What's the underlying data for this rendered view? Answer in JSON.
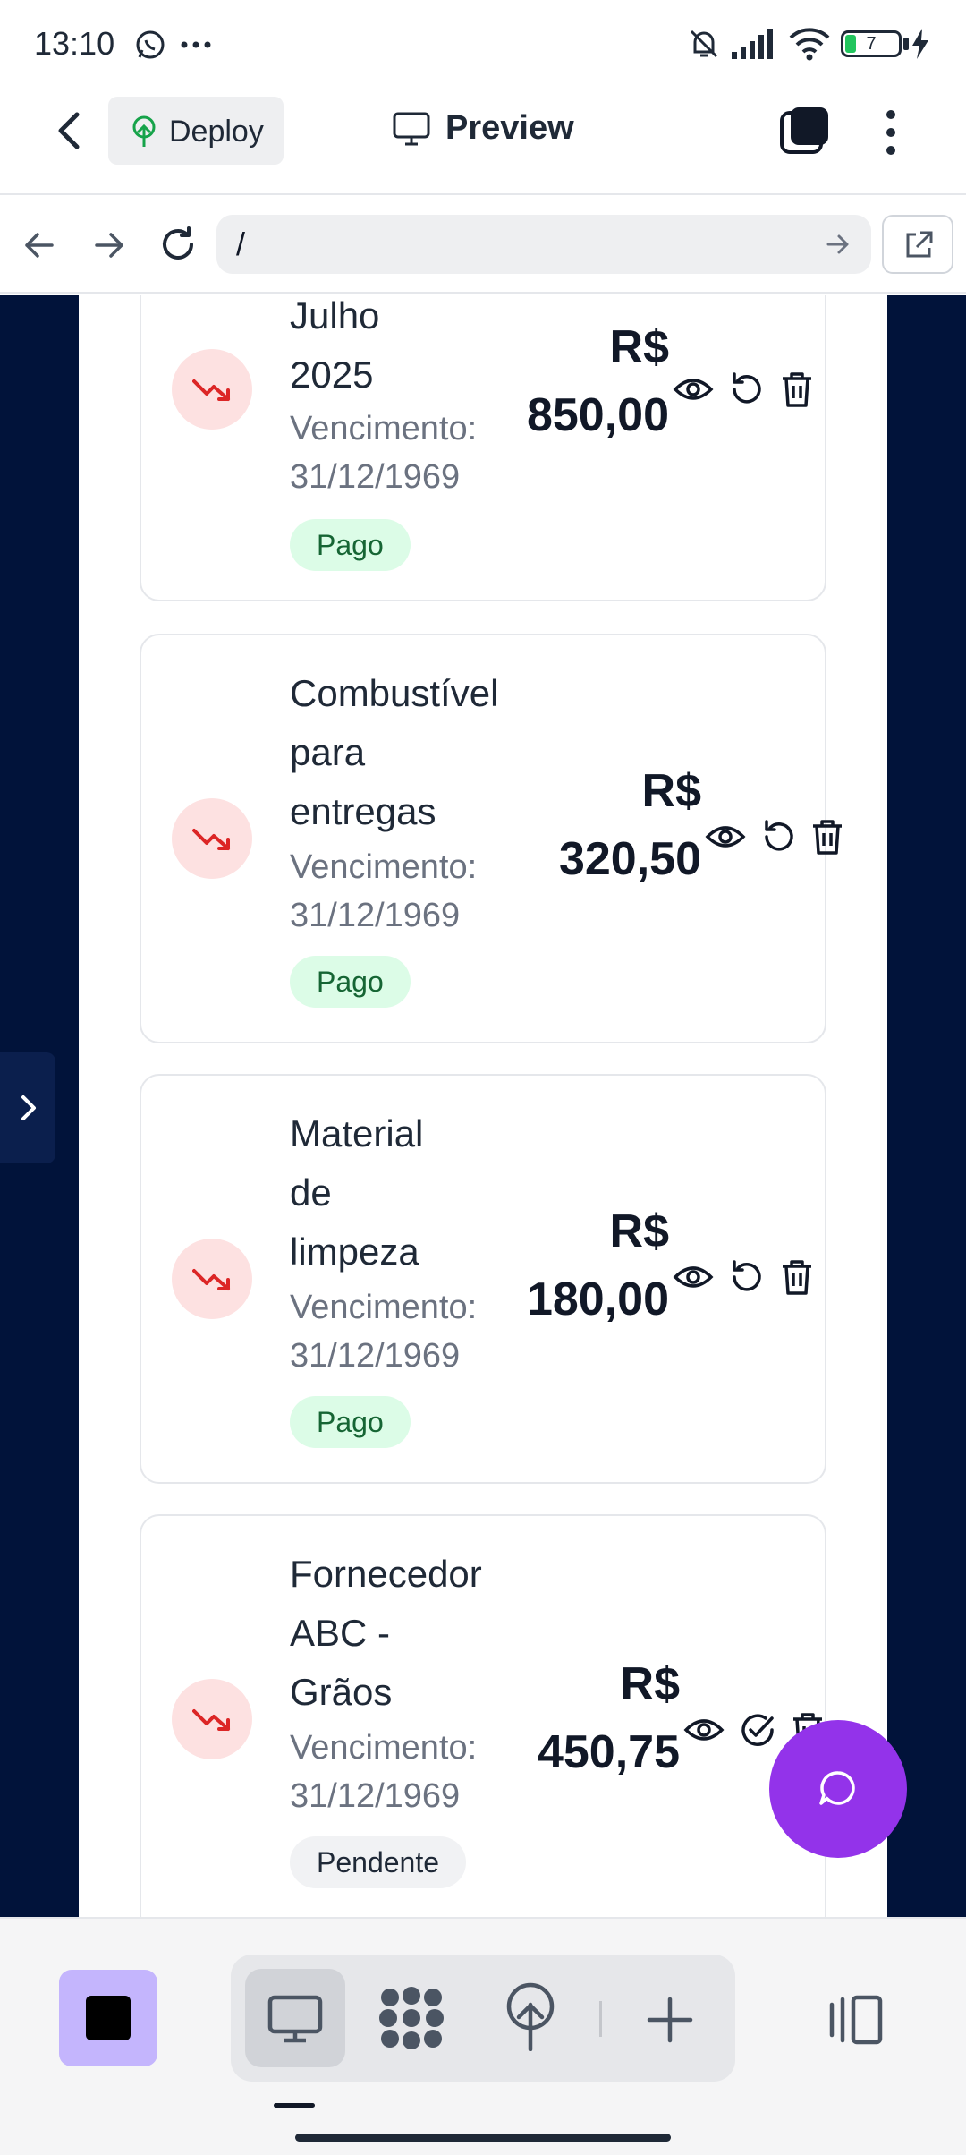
{
  "status_bar": {
    "time": "13:10",
    "battery": "7"
  },
  "app_bar": {
    "deploy_label": "Deploy",
    "preview_label": "Preview"
  },
  "url_bar": {
    "path": "/"
  },
  "colors": {
    "accent_purple": "#9333ea",
    "page_bg": "#01133a",
    "paid_badge": "#dcfce7",
    "expense_icon": "#dc2626"
  },
  "expenses": [
    {
      "title_lines": [
        "Julho",
        "2025"
      ],
      "due_label": "Vencimento:",
      "due_date": "31/12/1969",
      "currency": "R$",
      "amount": "850,00",
      "status": "Pago",
      "actions": [
        "eye-icon",
        "undo-icon",
        "trash-icon"
      ]
    },
    {
      "title_lines": [
        "Combustível",
        "para",
        "entregas"
      ],
      "due_label": "Vencimento:",
      "due_date": "31/12/1969",
      "currency": "R$",
      "amount": "320,50",
      "status": "Pago",
      "actions": [
        "eye-icon",
        "undo-icon",
        "trash-icon"
      ]
    },
    {
      "title_lines": [
        "Material",
        "de",
        "limpeza"
      ],
      "due_label": "Vencimento:",
      "due_date": "31/12/1969",
      "currency": "R$",
      "amount": "180,00",
      "status": "Pago",
      "actions": [
        "eye-icon",
        "undo-icon",
        "trash-icon"
      ]
    },
    {
      "title_lines": [
        "Fornecedor",
        "ABC -",
        "Grãos"
      ],
      "due_label": "Vencimento:",
      "due_date": "31/12/1969",
      "currency": "R$",
      "amount": "450,75",
      "status": "Pendente",
      "actions": [
        "eye-icon",
        "check-circle-icon",
        "trash-icon"
      ]
    }
  ],
  "bottom_bar": {
    "modes": [
      "monitor-icon",
      "grid-icon",
      "deploy-icon",
      "plus-icon"
    ]
  }
}
